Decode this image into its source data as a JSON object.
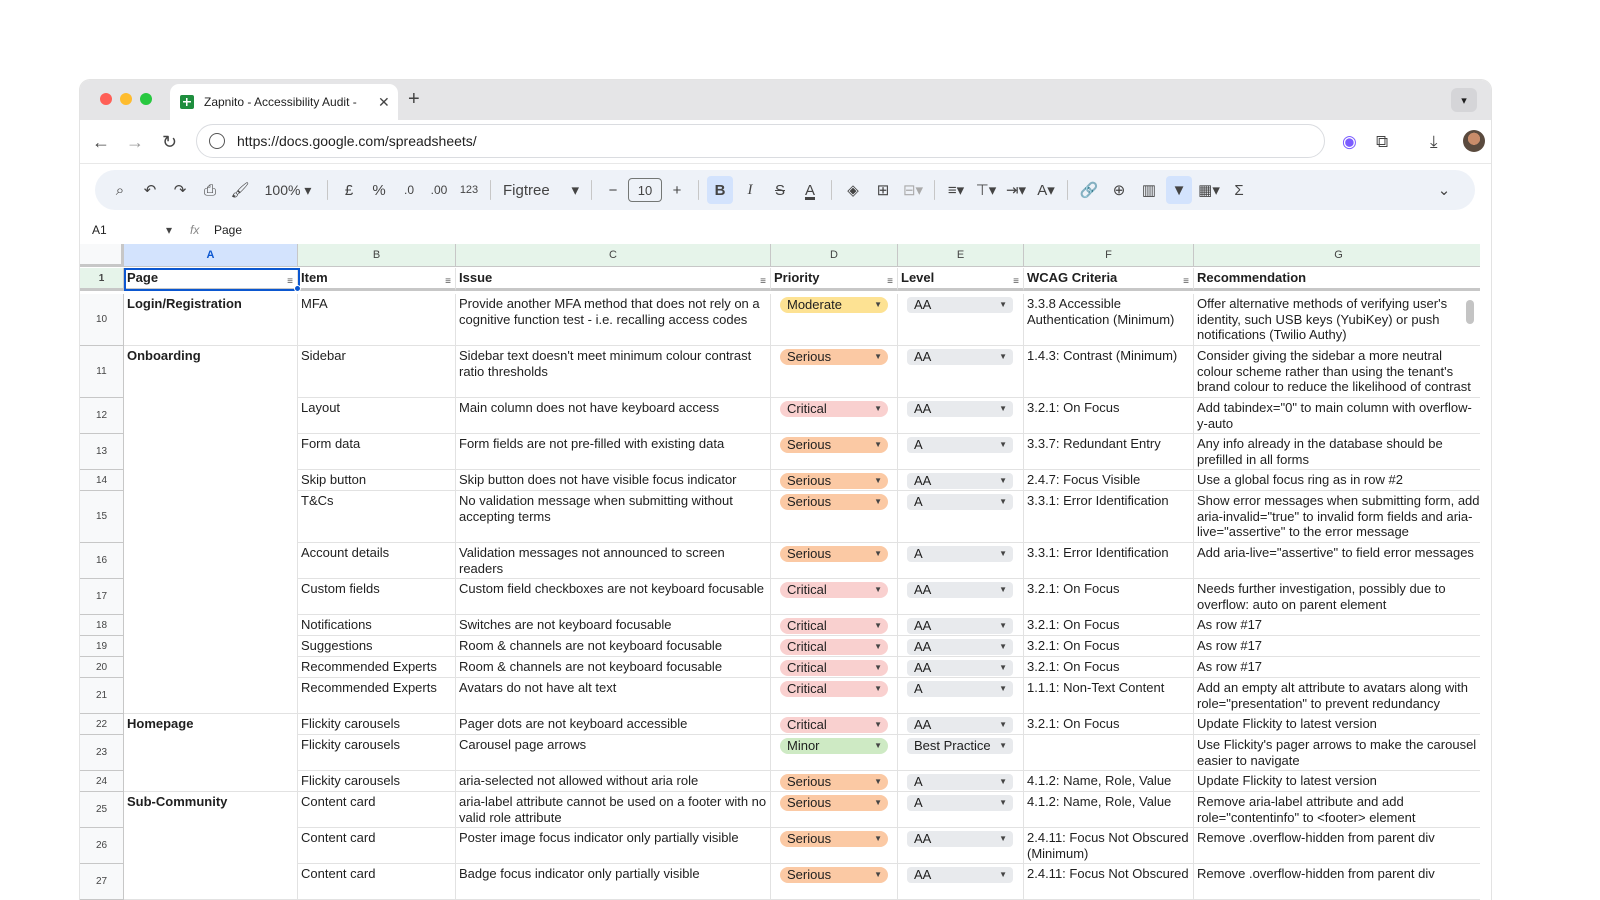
{
  "browser": {
    "tab_title": "Zapnito - Accessibility Audit -",
    "url": "https://docs.google.com/spreadsheets/"
  },
  "toolbar": {
    "zoom": "100%",
    "currency": "£",
    "percent": "%",
    "dec_less": ".0",
    "dec_more": ".00",
    "format_123": "123",
    "font": "Figtree",
    "font_size": "10",
    "bold": "B",
    "italic": "I",
    "sum": "Σ"
  },
  "formula_bar": {
    "cell_ref": "A1",
    "fx": "fx",
    "value": "Page"
  },
  "columns": [
    "A",
    "B",
    "C",
    "D",
    "E",
    "F",
    "G"
  ],
  "headers": [
    "Page",
    "Item",
    "Issue",
    "Priority",
    "Level",
    "WCAG Criteria",
    "Recommendation"
  ],
  "colors": {
    "Moderate": "#fde293",
    "Serious": "#fbc9a4",
    "Critical": "#f9d0cf",
    "Minor": "#ceeac4",
    "selection": "#0b57d0",
    "header_highlight": "#e6f4ea"
  },
  "rows": [
    {
      "num": "10",
      "page": "Login/Registration",
      "item": "MFA",
      "issue": "Provide another MFA method that does not rely on a cognitive function test - i.e. recalling access codes",
      "priority": "Moderate",
      "level": "AA",
      "wcag": "3.3.8 Accessible Authentication (Minimum)",
      "rec": "Offer alternative methods of verifying user's identity, such USB keys (YubiKey) or push notifications (Twilio Authy)"
    },
    {
      "num": "11",
      "page": "Onboarding",
      "item": "Sidebar",
      "issue": "Sidebar text doesn't meet minimum colour contrast ratio thresholds",
      "priority": "Serious",
      "level": "AA",
      "wcag": "1.4.3: Contrast (Minimum)",
      "rec": "Consider giving the sidebar a more neutral colour scheme rather than using the tenant's brand colour to reduce the likelihood of contrast issues"
    },
    {
      "num": "12",
      "page": "",
      "item": "Layout",
      "issue": "Main column does not have keyboard access",
      "priority": "Critical",
      "level": "AA",
      "wcag": "3.2.1: On Focus",
      "rec": "Add tabindex=\"0\" to main column with overflow-y-auto"
    },
    {
      "num": "13",
      "page": "",
      "item": "Form data",
      "issue": "Form fields are not pre-filled with existing data",
      "priority": "Serious",
      "level": "A",
      "wcag": "3.3.7: Redundant Entry",
      "rec": "Any info already in the database should be prefilled in all forms"
    },
    {
      "num": "14",
      "page": "",
      "item": "Skip button",
      "issue": "Skip button does not have visible focus indicator",
      "priority": "Serious",
      "level": "AA",
      "wcag": "2.4.7: Focus Visible",
      "rec": "Use a global focus ring as in row #2"
    },
    {
      "num": "15",
      "page": "",
      "item": "T&Cs",
      "issue": "No validation message when submitting without accepting terms",
      "priority": "Serious",
      "level": "A",
      "wcag": "3.3.1: Error Identification",
      "rec": "Show error messages when submitting form, add aria-invalid=\"true\" to invalid form fields and aria-live=\"assertive\" to the error message"
    },
    {
      "num": "16",
      "page": "",
      "item": "Account details",
      "issue": "Validation messages not announced to screen readers",
      "priority": "Serious",
      "level": "A",
      "wcag": "3.3.1: Error Identification",
      "rec": "Add aria-live=\"assertive\" to field error messages"
    },
    {
      "num": "17",
      "page": "",
      "item": "Custom fields",
      "issue": "Custom field checkboxes are not keyboard focusable",
      "priority": "Critical",
      "level": "AA",
      "wcag": "3.2.1: On Focus",
      "rec": "Needs further investigation, possibly due to overflow: auto on parent element"
    },
    {
      "num": "18",
      "page": "",
      "item": "Notifications",
      "issue": "Switches are not keyboard focusable",
      "priority": "Critical",
      "level": "AA",
      "wcag": "3.2.1: On Focus",
      "rec": "As row #17"
    },
    {
      "num": "19",
      "page": "",
      "item": "Suggestions",
      "issue": "Room & channels are not keyboard focusable",
      "priority": "Critical",
      "level": "AA",
      "wcag": "3.2.1: On Focus",
      "rec": "As row #17"
    },
    {
      "num": "20",
      "page": "",
      "item": "Recommended Experts",
      "issue": "Room & channels are not keyboard focusable",
      "priority": "Critical",
      "level": "AA",
      "wcag": "3.2.1: On Focus",
      "rec": "As row #17"
    },
    {
      "num": "21",
      "page": "",
      "item": "Recommended Experts",
      "issue": "Avatars do not have alt text",
      "priority": "Critical",
      "level": "A",
      "wcag": "1.1.1: Non-Text Content",
      "rec": "Add an empty alt attribute to avatars along with role=\"presentation\" to prevent redundancy"
    },
    {
      "num": "22",
      "page": "Homepage",
      "item": "Flickity carousels",
      "issue": "Pager dots are not keyboard accessible",
      "priority": "Critical",
      "level": "AA",
      "wcag": "3.2.1: On Focus",
      "rec": "Update Flickity to latest version"
    },
    {
      "num": "23",
      "page": "",
      "item": "Flickity carousels",
      "issue": "Carousel page arrows",
      "priority": "Minor",
      "level": "Best Practice",
      "wcag": "",
      "rec": "Use Flickity's pager arrows to make the carousel easier to navigate"
    },
    {
      "num": "24",
      "page": "",
      "item": "Flickity carousels",
      "issue": "aria-selected not allowed without aria role",
      "priority": "Serious",
      "level": "A",
      "wcag": "4.1.2: Name, Role, Value",
      "rec": "Update Flickity to latest version"
    },
    {
      "num": "25",
      "page": "Sub-Community",
      "item": "Content card",
      "issue": "aria-label attribute cannot be used on a footer with no valid role attribute",
      "priority": "Serious",
      "level": "A",
      "wcag": "4.1.2: Name, Role, Value",
      "rec": "Remove aria-label attribute and add role=\"contentinfo\" to <footer> element"
    },
    {
      "num": "26",
      "page": "",
      "item": "Content card",
      "issue": "Poster image focus indicator only partially visible",
      "priority": "Serious",
      "level": "AA",
      "wcag": "2.4.11: Focus Not Obscured (Minimum)",
      "rec": "Remove .overflow-hidden from parent div"
    },
    {
      "num": "27",
      "page": "",
      "item": "Content card",
      "issue": "Badge focus indicator only partially visible",
      "priority": "Serious",
      "level": "AA",
      "wcag": "2.4.11: Focus Not Obscured",
      "rec": "Remove .overflow-hidden from parent div"
    }
  ]
}
